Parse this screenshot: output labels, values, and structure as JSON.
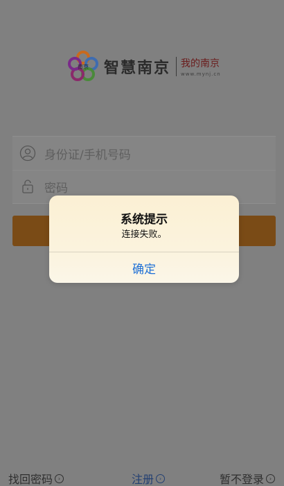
{
  "logo": {
    "mark_text": "南京",
    "name": "智慧南京",
    "subtitle": "我的南京",
    "url": "www.mynj.cn"
  },
  "form": {
    "id_placeholder": "身份证/手机号码",
    "password_placeholder": "密码",
    "id_icon": "user-icon",
    "password_icon": "lock-icon"
  },
  "links": {
    "find_password": "找回密码",
    "register": "注册",
    "skip_login": "暂不登录",
    "arrow_icon": "circle-arrow-right-icon"
  },
  "alert": {
    "title": "系统提示",
    "message": "连接失败。",
    "confirm": "确定"
  },
  "colors": {
    "overlay": "#808080",
    "login_button": "#7a4b16",
    "alert_button_text": "#1d6fd6",
    "register_link": "#223f72"
  }
}
